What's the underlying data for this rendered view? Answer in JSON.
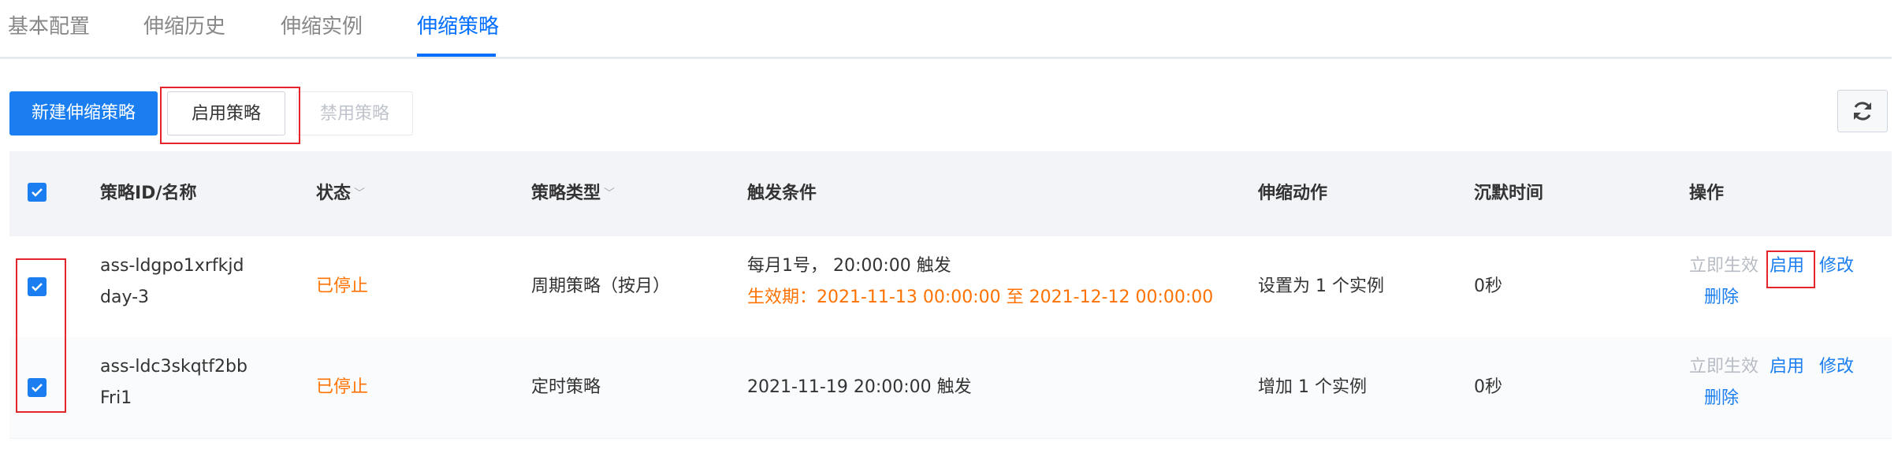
{
  "tabs": [
    {
      "label": "基本配置"
    },
    {
      "label": "伸缩历史"
    },
    {
      "label": "伸缩实例"
    },
    {
      "label": "伸缩策略"
    }
  ],
  "toolbar": {
    "create_label": "新建伸缩策略",
    "enable_label": "启用策略",
    "disable_label": "禁用策略"
  },
  "table": {
    "headers": {
      "id_name": "策略ID/名称",
      "status": "状态",
      "type": "策略类型",
      "trigger": "触发条件",
      "action": "伸缩动作",
      "cooldown": "沉默时间",
      "ops": "操作"
    },
    "rows": [
      {
        "id": "ass-ldgpo1xrfkjd",
        "name": "day-3",
        "status": "已停止",
        "type": "周期策略（按月）",
        "trigger": "每月1号， 20:00:00 触发",
        "validity": "生效期：2021-11-13 00:00:00 至 2021-12-12 00:00:00",
        "action": "设置为 1 个实例",
        "cooldown": "0秒",
        "op_now": "立即生效",
        "op_enable": "启用",
        "op_modify": "修改",
        "op_delete": "删除"
      },
      {
        "id": "ass-ldc3skqtf2bb",
        "name": "Fri1",
        "status": "已停止",
        "type": "定时策略",
        "trigger": "2021-11-19 20:00:00 触发",
        "action": "增加 1 个实例",
        "cooldown": "0秒",
        "op_now": "立即生效",
        "op_enable": "启用",
        "op_modify": "修改",
        "op_delete": "删除"
      }
    ]
  },
  "colors": {
    "accent": "#006eff",
    "primary_button": "#1a7ef0",
    "stopped_status": "#ff7200",
    "annotation": "#e5242b"
  }
}
